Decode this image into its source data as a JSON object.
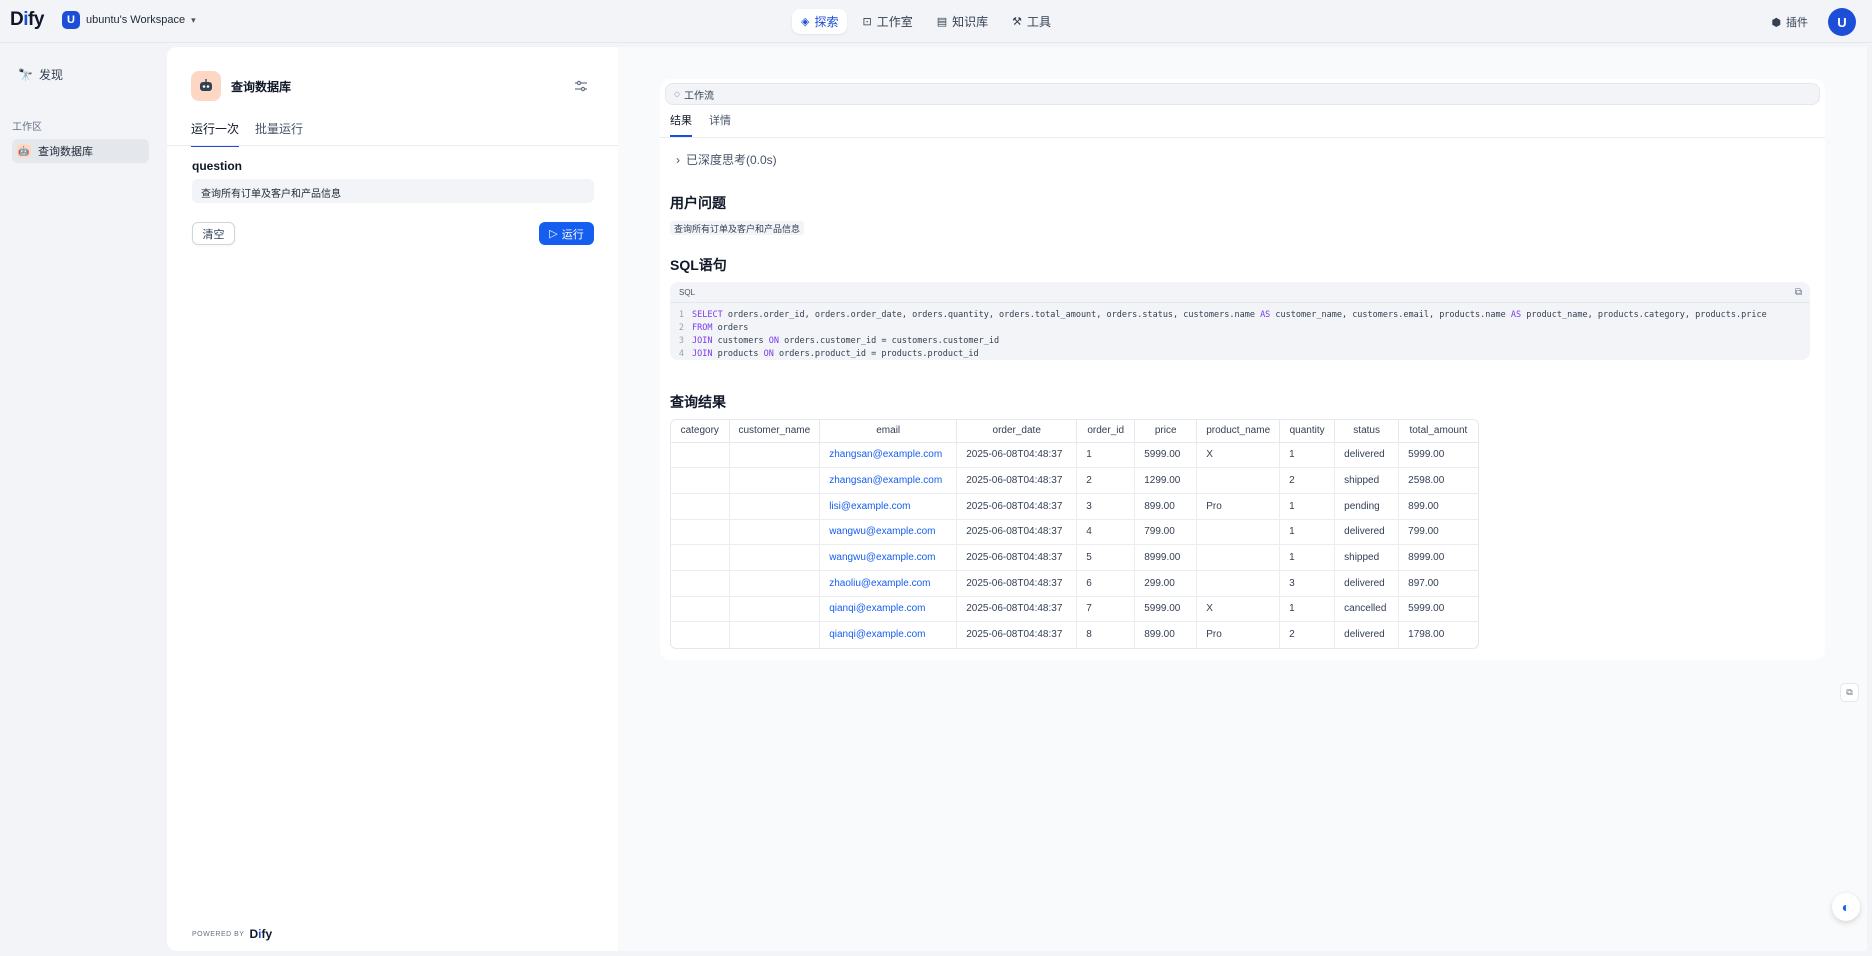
{
  "topbar": {
    "logo": {
      "d": "D",
      "i": "i",
      "rest": "fy"
    },
    "workspace_badge": "U",
    "workspace_name": "ubuntu's Workspace",
    "nav": [
      {
        "label": "探索",
        "icon": "compass-icon",
        "active": true
      },
      {
        "label": "工作室",
        "icon": "robot-icon",
        "active": false
      },
      {
        "label": "知识库",
        "icon": "book-icon",
        "active": false
      },
      {
        "label": "工具",
        "icon": "hammer-icon",
        "active": false
      }
    ],
    "plugins_label": "插件",
    "avatar_letter": "U"
  },
  "sidebar": {
    "discover_label": "发现",
    "section_label": "工作区",
    "app_label": "查询数据库"
  },
  "run_panel": {
    "app_name": "查询数据库",
    "tabs": [
      "运行一次",
      "批量运行"
    ],
    "question_label": "question",
    "question_value": "查询所有订单及客户和产品信息",
    "clear_label": "清空",
    "run_label": "运行",
    "powered_by": "POWERED BY",
    "powered_brand": {
      "d": "D",
      "i": "i",
      "rest": "fy"
    }
  },
  "result": {
    "workflow_chip": "工作流",
    "tabs": [
      "结果",
      "详情"
    ],
    "think_label": "已深度思考(0.0s)",
    "user_question_heading": "用户问题",
    "user_question": "查询所有订单及客户和产品信息",
    "sql_heading": "SQL语句",
    "code_lang": "SQL",
    "code": {
      "l1": {
        "kw1": "SELECT",
        "a": " orders.order_id, orders.order_date, orders.quantity, orders.total_amount, orders.status, customers.name ",
        "kw2": "AS",
        "b": " customer_name, customers.email, products.name ",
        "kw3": "AS",
        "c": " product_name, products.category, products.price"
      },
      "l2": {
        "kw": "FROM",
        "rest": " orders"
      },
      "l3": {
        "kw1": "JOIN",
        "a": " customers ",
        "kw2": "ON",
        "b": " orders.customer_id = customers.customer_id"
      },
      "l4": {
        "kw1": "JOIN",
        "a": " products ",
        "kw2": "ON",
        "b": " orders.product_id = products.product_id"
      }
    },
    "results_heading": "查询结果",
    "table": {
      "columns": [
        "category",
        "customer_name",
        "email",
        "order_date",
        "order_id",
        "price",
        "product_name",
        "quantity",
        "status",
        "total_amount"
      ],
      "rows": [
        [
          "",
          "",
          "zhangsan@example.com",
          "2025-06-08T04:48:37",
          "1",
          "5999.00",
          "X",
          "1",
          "delivered",
          "5999.00"
        ],
        [
          "",
          "",
          "zhangsan@example.com",
          "2025-06-08T04:48:37",
          "2",
          "1299.00",
          "",
          "2",
          "shipped",
          "2598.00"
        ],
        [
          "",
          "",
          "lisi@example.com",
          "2025-06-08T04:48:37",
          "3",
          "899.00",
          "Pro",
          "1",
          "pending",
          "899.00"
        ],
        [
          "",
          "",
          "wangwu@example.com",
          "2025-06-08T04:48:37",
          "4",
          "799.00",
          "",
          "1",
          "delivered",
          "799.00"
        ],
        [
          "",
          "",
          "wangwu@example.com",
          "2025-06-08T04:48:37",
          "5",
          "8999.00",
          "",
          "1",
          "shipped",
          "8999.00"
        ],
        [
          "",
          "",
          "zhaoliu@example.com",
          "2025-06-08T04:48:37",
          "6",
          "299.00",
          "",
          "3",
          "delivered",
          "897.00"
        ],
        [
          "",
          "",
          "qianqi@example.com",
          "2025-06-08T04:48:37",
          "7",
          "5999.00",
          "X",
          "1",
          "cancelled",
          "5999.00"
        ],
        [
          "",
          "",
          "qianqi@example.com",
          "2025-06-08T04:48:37",
          "8",
          "899.00",
          "Pro",
          "2",
          "delivered",
          "1798.00"
        ]
      ]
    }
  }
}
